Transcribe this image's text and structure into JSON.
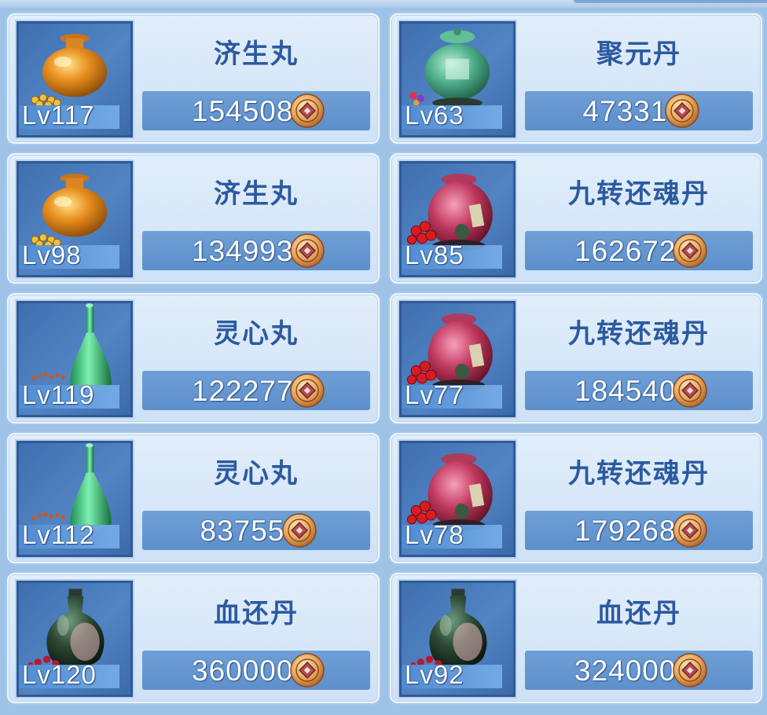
{
  "items": [
    {
      "name": "济生丸",
      "level": "Lv117",
      "price": "154508",
      "icon": "gold-urn-icon"
    },
    {
      "name": "聚元丹",
      "level": "Lv63",
      "price": "47331",
      "icon": "jade-jar-icon"
    },
    {
      "name": "济生丸",
      "level": "Lv98",
      "price": "134993",
      "icon": "gold-urn-icon"
    },
    {
      "name": "九转还魂丹",
      "level": "Lv85",
      "price": "162672",
      "icon": "red-jar-icon"
    },
    {
      "name": "灵心丸",
      "level": "Lv119",
      "price": "122277",
      "icon": "green-vase-icon"
    },
    {
      "name": "九转还魂丹",
      "level": "Lv77",
      "price": "184540",
      "icon": "red-jar-icon"
    },
    {
      "name": "灵心丸",
      "level": "Lv112",
      "price": "83755",
      "icon": "green-vase-icon"
    },
    {
      "name": "九转还魂丹",
      "level": "Lv78",
      "price": "179268",
      "icon": "red-jar-icon"
    },
    {
      "name": "血还丹",
      "level": "Lv120",
      "price": "360000",
      "icon": "dark-flask-icon"
    },
    {
      "name": "血还丹",
      "level": "Lv92",
      "price": "324000",
      "icon": "dark-flask-icon"
    }
  ],
  "currency_icon": "copper-coin-icon",
  "colors": {
    "name_text": "#2c5aa0",
    "price_bar": "#6f9fd6",
    "slot_bg": "#4a7cbd",
    "panel_bg": "#9fc3e6"
  }
}
